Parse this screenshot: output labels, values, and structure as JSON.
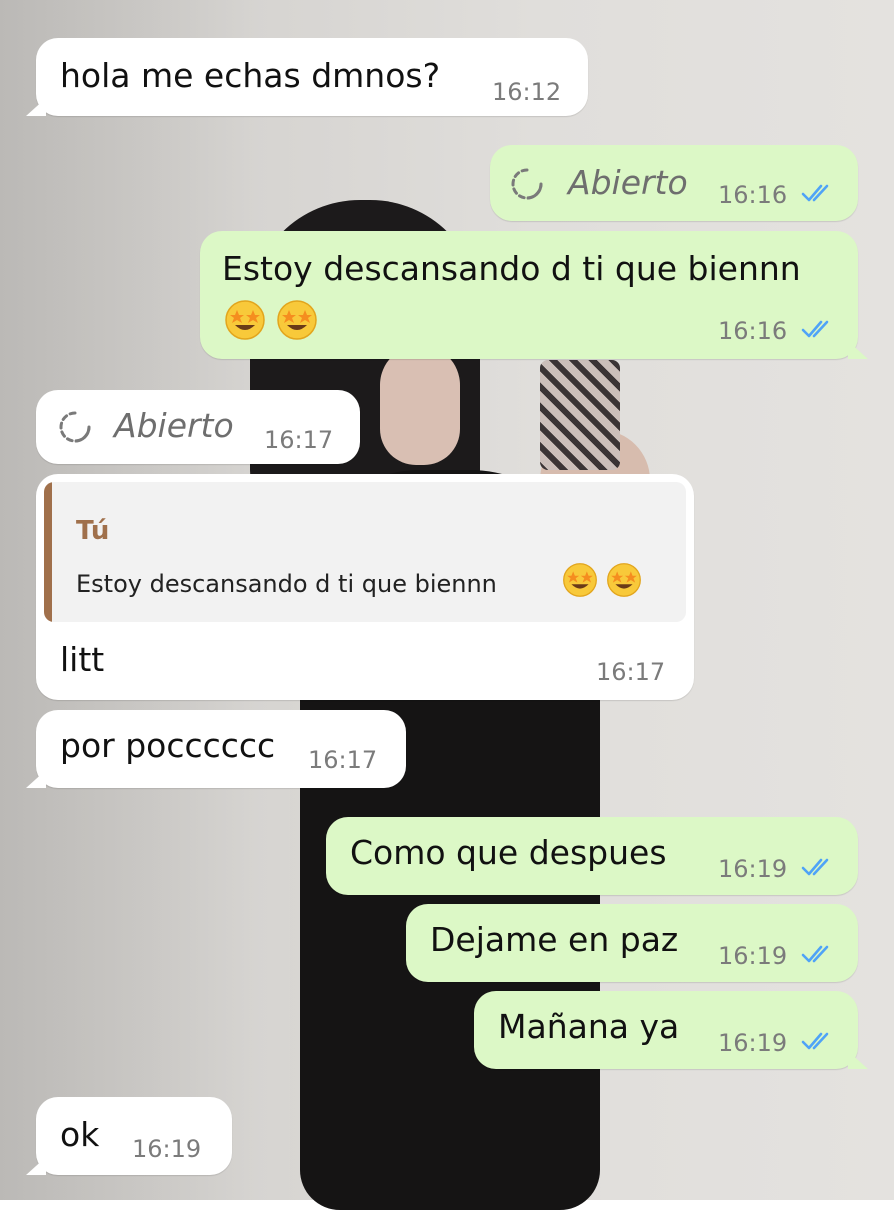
{
  "chat": {
    "messages": [
      {
        "text": "hola me echas dmnos?",
        "time": "16:12"
      },
      {
        "text": "Abierto",
        "time": "16:16",
        "status_icon": "double-check-icon"
      },
      {
        "text": "Estoy descansando d ti que biennn",
        "emoji": "star-struck-emoji",
        "time": "16:16",
        "status_icon": "double-check-icon"
      },
      {
        "text": "Abierto",
        "time": "16:17"
      },
      {
        "quote_author": "Tú",
        "quote_text": "Estoy descansando d ti que biennn",
        "text": "litt",
        "time": "16:17"
      },
      {
        "text": "por pocccccc",
        "time": "16:17"
      },
      {
        "text": "Como que despues",
        "time": "16:19",
        "status_icon": "double-check-icon"
      },
      {
        "text": "Dejame en paz",
        "time": "16:19",
        "status_icon": "double-check-icon"
      },
      {
        "text": "Mañana ya",
        "time": "16:19",
        "status_icon": "double-check-icon"
      },
      {
        "text": "ok",
        "time": "16:19"
      }
    ]
  },
  "colors": {
    "incoming_bubble": "#ffffff",
    "outgoing_bubble": "#dcf8c6",
    "read_ticks": "#4fa3f7",
    "quote_accent": "#a0704b"
  }
}
